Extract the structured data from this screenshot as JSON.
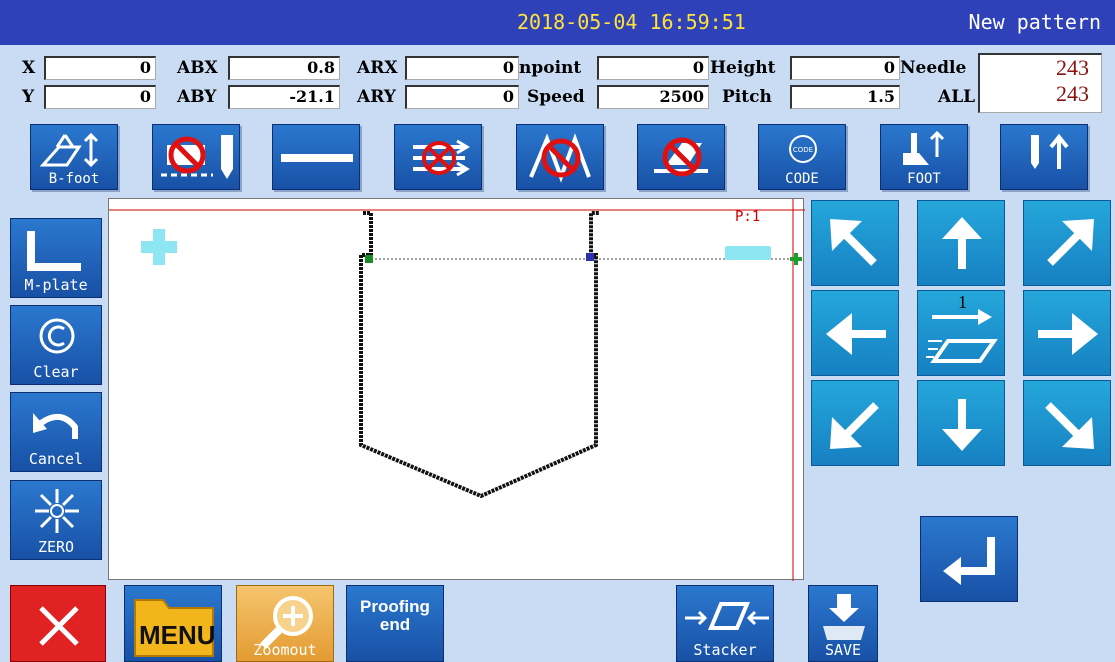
{
  "header": {
    "datetime": "2018-05-04 16:59:51",
    "pattern_name": "New pattern"
  },
  "fields": {
    "x_label": "X",
    "x_value": "0",
    "y_label": "Y",
    "y_value": "0",
    "abx_label": "ABX",
    "abx_value": "0.8",
    "aby_label": "ABY",
    "aby_value": "-21.1",
    "arx_label": "ARX",
    "arx_value": "0",
    "ary_label": "ARY",
    "ary_value": "0",
    "npoint_label": "npoint",
    "npoint_value": "0",
    "speed_label": "Speed",
    "speed_value": "2500",
    "height_label": "Height",
    "height_value": "0",
    "pitch_label": "Pitch",
    "pitch_value": "1.5",
    "needle_label": "Needle",
    "needle_value": "243",
    "all_label": "ALL",
    "all_value": "243"
  },
  "toolbar": {
    "bfoot": "B-foot",
    "code": "CODE",
    "foot": "FOOT"
  },
  "sidebar": {
    "mplate": "M-plate",
    "clear": "Clear",
    "cancel": "Cancel",
    "zero": "ZERO"
  },
  "canvas": {
    "point_label": "P:1",
    "step_number": "1"
  },
  "bottom": {
    "menu": "MENU",
    "zoomout": "Zoomout",
    "proofing_line1": "Proofing",
    "proofing_line2": "end",
    "stacker": "Stacker",
    "save": "SAVE"
  },
  "colors": {
    "title_bar": "#2f41b8",
    "datetime": "#ffe23a",
    "button_blue": "#1f62b8",
    "arrow_cyan": "#1f95d2",
    "needle_count": "#8a1010",
    "canvas_border": "#d00000"
  },
  "icons": [
    "bfoot-icon",
    "trim-off-icon",
    "line-icon",
    "feed-off-icon",
    "zigzag-off-icon",
    "presser-off-icon",
    "code-icon",
    "foot-icon",
    "needle-updown-icon",
    "mplate-icon",
    "copyright-icon",
    "undo-icon",
    "zero-icon",
    "close-icon",
    "folder-icon",
    "zoom-icon",
    "stacker-icon",
    "save-icon",
    "enter-icon"
  ]
}
